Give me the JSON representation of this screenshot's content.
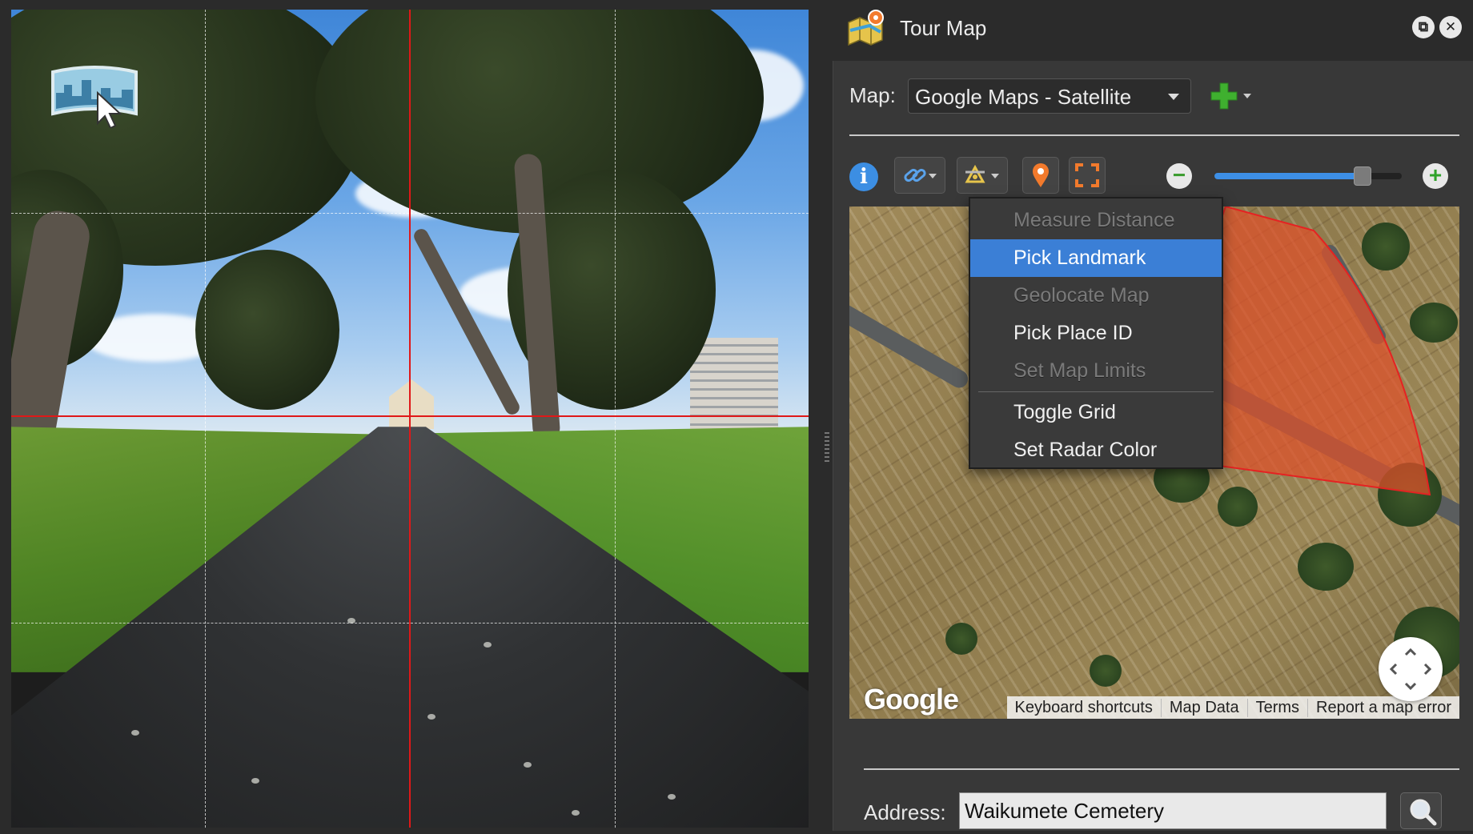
{
  "panel": {
    "title": "Tour Map",
    "map_label": "Map:",
    "map_provider": "Google Maps - Satellite",
    "address_label": "Address:",
    "address_value": "Waikumete Cemetery"
  },
  "window_controls": {
    "restore_glyph": "⧉",
    "close_glyph": "✕"
  },
  "toolbar": {
    "info_glyph": "i",
    "zoom_minus_glyph": "−",
    "zoom_plus_glyph": "+",
    "zoom_level_fraction": 0.79
  },
  "menu": {
    "items": [
      {
        "label": "Measure Distance",
        "state": "disabled"
      },
      {
        "label": "Pick Landmark",
        "state": "selected"
      },
      {
        "label": "Geolocate Map",
        "state": "disabled"
      },
      {
        "label": "Pick Place ID",
        "state": "enabled"
      },
      {
        "label": "Set Map Limits",
        "state": "disabled"
      },
      {
        "label": "Toggle Grid",
        "state": "enabled"
      },
      {
        "label": "Set Radar Color",
        "state": "enabled"
      }
    ]
  },
  "map": {
    "logo_text": "Google",
    "footer": {
      "keyboard": "Keyboard shortcuts",
      "data": "Map Data",
      "terms": "Terms",
      "report": "Report a map error"
    }
  },
  "colors": {
    "accent": "#3b7fd6",
    "crosshair": "#e01818",
    "radar_fill": "#e0502a"
  },
  "icons": [
    "pano-viewer-icon",
    "tour-map-icon",
    "restore-icon",
    "close-icon",
    "add-map-icon",
    "info-icon",
    "link-icon",
    "tools-icon",
    "map-pin-icon",
    "fullscreen-icon",
    "zoom-out-icon",
    "zoom-in-icon",
    "pan-control-icon",
    "search-icon"
  ]
}
